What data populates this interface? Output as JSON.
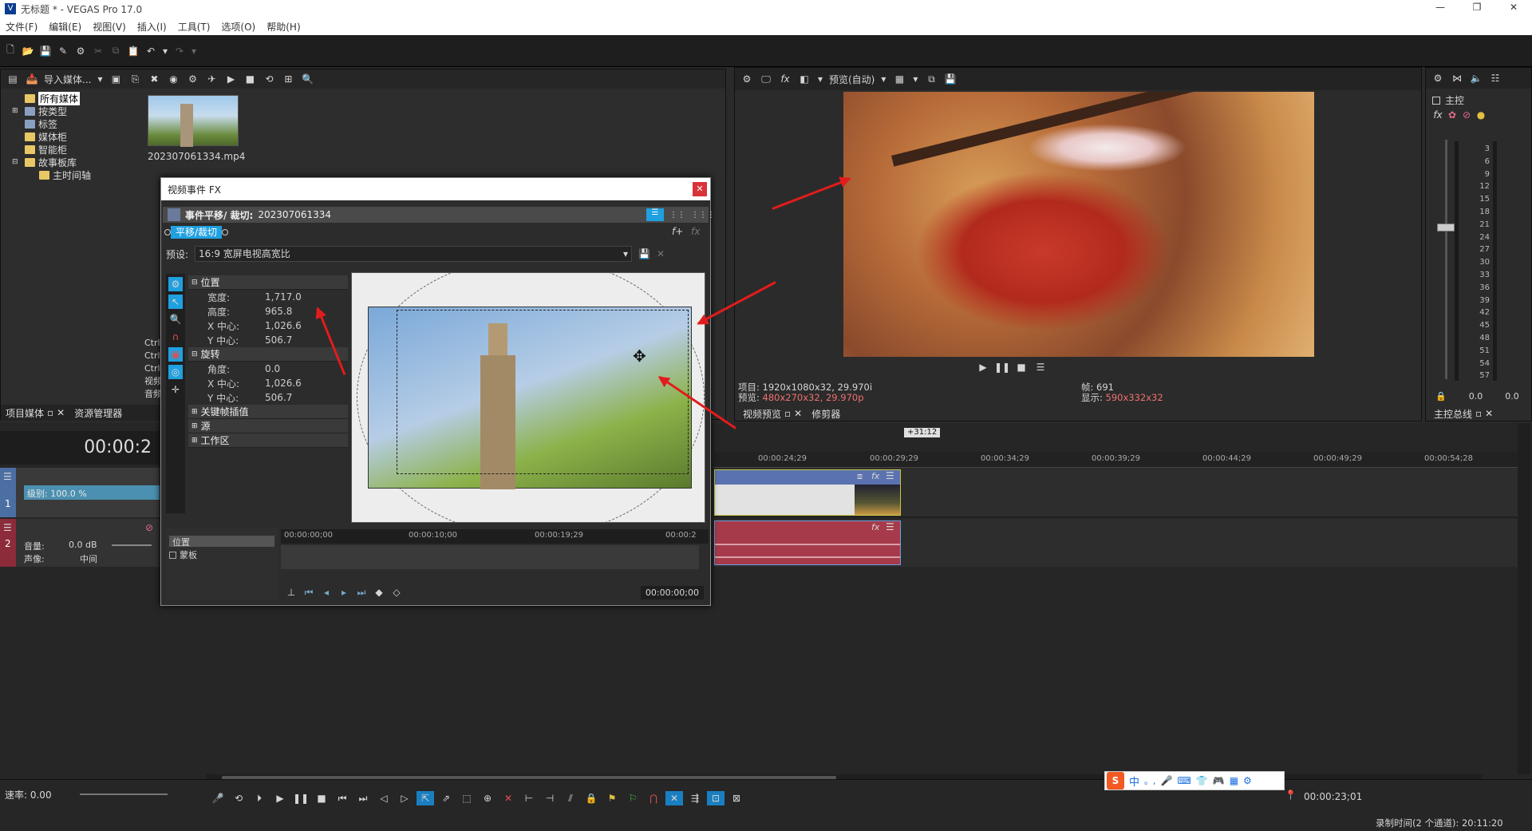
{
  "app": {
    "title": "无标题 * - VEGAS Pro 17.0"
  },
  "menu": [
    "文件(F)",
    "编辑(E)",
    "视图(V)",
    "插入(I)",
    "工具(T)",
    "选项(O)",
    "帮助(H)"
  ],
  "media_panel": {
    "import_label": "导入媒体...",
    "tree": [
      "所有媒体",
      "按类型",
      "标签",
      "媒体柜",
      "智能柜",
      "故事板库",
      "主时间轴"
    ],
    "file_name": "202307061334.mp4",
    "tabs": [
      "项目媒体",
      "资源管理器"
    ],
    "partial_texts": [
      "Ctrl",
      "Ctrl",
      "Ctrl",
      "视频",
      "音频"
    ]
  },
  "preview": {
    "mode_label": "预览(自动)",
    "project_label": "项目:",
    "project_value": "1920x1080x32, 29.970i",
    "preview_label": "预览:",
    "preview_value": "480x270x32, 29.970p",
    "frame_label": "帧:",
    "frame_value": "691",
    "display_label": "显示:",
    "display_value": "590x332x32",
    "tabs": [
      "视频预览",
      "修剪器"
    ]
  },
  "master": {
    "label": "主控",
    "scale": [
      "3",
      "6",
      "9",
      "12",
      "15",
      "18",
      "21",
      "24",
      "27",
      "30",
      "33",
      "36",
      "39",
      "42",
      "45",
      "48",
      "51",
      "54",
      "57"
    ],
    "db_left": "0.0",
    "db_right": "0.0",
    "tab": "主控总线"
  },
  "fx_dialog": {
    "title": "视频事件 FX",
    "chain_label": "事件平移/ 裁切:",
    "chain_value": "202307061334",
    "plugin_tab": "平移/裁切",
    "preset_label": "预设:",
    "preset_value": "16:9 宽屏电视高宽比",
    "groups": {
      "position": {
        "label": "位置",
        "rows": [
          {
            "k": "宽度:",
            "v": "1,717.0"
          },
          {
            "k": "高度:",
            "v": "965.8"
          },
          {
            "k": "X 中心:",
            "v": "1,026.6"
          },
          {
            "k": "Y 中心:",
            "v": "506.7"
          }
        ]
      },
      "rotation": {
        "label": "旋转",
        "rows": [
          {
            "k": "角度:",
            "v": "0.0"
          },
          {
            "k": "X 中心:",
            "v": "1,026.6"
          },
          {
            "k": "Y 中心:",
            "v": "506.7"
          }
        ]
      },
      "keyframe": "关键帧插值",
      "source": "源",
      "workspace": "工作区"
    },
    "tracks": [
      "位置",
      "蒙板"
    ],
    "ruler": [
      "00:00:00;00",
      "00:00:10;00",
      "00:00:19;29",
      "00:00:2"
    ],
    "time": "00:00:00;00"
  },
  "timeline": {
    "time_display": "00:00:2",
    "badge": "+31:12",
    "ruler": [
      "00:00:24;29",
      "00:00:29;29",
      "00:00:34;29",
      "00:00:39;29",
      "00:00:44;29",
      "00:00:49;29",
      "00:00:54;28"
    ],
    "video_track": {
      "num": "1",
      "level_label": "级别: 100.0 %"
    },
    "audio_track": {
      "num": "2",
      "volume_label": "音量:",
      "volume_value": "0.0 dB",
      "pan_label": "声像:",
      "pan_value": "中间"
    },
    "rate_label": "速率: 0.00",
    "current_time": "00:00:23;01",
    "record_time": "录制时间(2 个通道): 20:11:20"
  },
  "ime": [
    "中",
    "。,",
    "🎤",
    "⌨",
    "👕",
    "🎮",
    "▦",
    "⚙"
  ],
  "colors": {
    "accent": "#1fa0e0",
    "red": "#e21c1c",
    "video_clip": "#5a72b0",
    "audio_clip": "#a63a4a"
  }
}
